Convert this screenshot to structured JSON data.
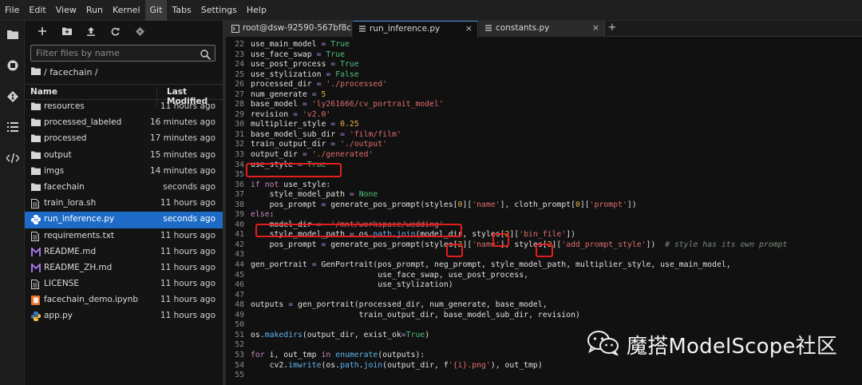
{
  "menubar": {
    "items": [
      "File",
      "Edit",
      "View",
      "Run",
      "Kernel",
      "Git",
      "Tabs",
      "Settings",
      "Help"
    ],
    "active_index": 5
  },
  "activity_icons": [
    "folder-icon",
    "running-icon",
    "git-icon",
    "list-icon",
    "code-icon"
  ],
  "filebrowser": {
    "toolbar_icons": [
      "new-launcher-icon",
      "new-folder-icon",
      "upload-icon",
      "refresh-icon",
      "git-clone-icon"
    ],
    "filter_placeholder": "Filter files by name",
    "breadcrumb": "/ facechain /",
    "columns": {
      "name": "Name",
      "modified": "Last Modified"
    },
    "files": [
      {
        "name": "resources",
        "modified": "11 hours ago",
        "type": "folder"
      },
      {
        "name": "processed_labeled",
        "modified": "16 minutes ago",
        "type": "folder"
      },
      {
        "name": "processed",
        "modified": "17 minutes ago",
        "type": "folder"
      },
      {
        "name": "output",
        "modified": "15 minutes ago",
        "type": "folder"
      },
      {
        "name": "imgs",
        "modified": "14 minutes ago",
        "type": "folder"
      },
      {
        "name": "facechain",
        "modified": "seconds ago",
        "type": "folder"
      },
      {
        "name": "train_lora.sh",
        "modified": "11 hours ago",
        "type": "file"
      },
      {
        "name": "run_inference.py",
        "modified": "seconds ago",
        "type": "python",
        "selected": true
      },
      {
        "name": "requirements.txt",
        "modified": "11 hours ago",
        "type": "file"
      },
      {
        "name": "README.md",
        "modified": "11 hours ago",
        "type": "markdown"
      },
      {
        "name": "README_ZH.md",
        "modified": "11 hours ago",
        "type": "markdown"
      },
      {
        "name": "LICENSE",
        "modified": "11 hours ago",
        "type": "file"
      },
      {
        "name": "facechain_demo.ipynb",
        "modified": "11 hours ago",
        "type": "notebook"
      },
      {
        "name": "app.py",
        "modified": "11 hours ago",
        "type": "python"
      }
    ]
  },
  "tabs": [
    {
      "label": "root@dsw-92590-567bf8c",
      "icon": "terminal-icon",
      "active": false
    },
    {
      "label": "run_inference.py",
      "icon": "file-icon",
      "active": true
    },
    {
      "label": "constants.py",
      "icon": "file-icon",
      "active": false
    }
  ],
  "editor": {
    "first_line_partial": "21",
    "lines": [
      {
        "n": "22",
        "code": "use_main_model = True"
      },
      {
        "n": "23",
        "code": "use_face_swap = True"
      },
      {
        "n": "24",
        "code": "use_post_process = True"
      },
      {
        "n": "25",
        "code": "use_stylization = False"
      },
      {
        "n": "26",
        "code": "processed_dir = './processed'"
      },
      {
        "n": "27",
        "code": "num_generate = 5"
      },
      {
        "n": "28",
        "code": "base_model = 'ly261666/cv_portrait_model'"
      },
      {
        "n": "29",
        "code": "revision = 'v2.0'"
      },
      {
        "n": "30",
        "code": "multiplier_style = 0.25"
      },
      {
        "n": "31",
        "code": "base_model_sub_dir = 'film/film'"
      },
      {
        "n": "32",
        "code": "train_output_dir = './output'"
      },
      {
        "n": "33",
        "code": "output_dir = './generated'"
      },
      {
        "n": "34",
        "code": "use_style = True"
      },
      {
        "n": "35",
        "code": ""
      },
      {
        "n": "36",
        "code": "if not use_style:"
      },
      {
        "n": "37",
        "code": "    style_model_path = None"
      },
      {
        "n": "38",
        "code": "    pos_prompt = generate_pos_prompt(styles[0]['name'], cloth_prompt[0]['prompt'])"
      },
      {
        "n": "39",
        "code": "else:"
      },
      {
        "n": "40",
        "code": "    model_dir =  '/mnt/workspace/wedding'"
      },
      {
        "n": "41",
        "code": "    style_model_path = os.path.join(model_dir, styles[2]['bin_file'])"
      },
      {
        "n": "42",
        "code": "    pos_prompt = generate_pos_prompt(styles[2]['name'], styles[2]['add_prompt_style'])  # style has its own prompt"
      },
      {
        "n": "43",
        "code": ""
      },
      {
        "n": "44",
        "code": "gen_portrait = GenPortrait(pos_prompt, neg_prompt, style_model_path, multiplier_style, use_main_model,"
      },
      {
        "n": "45",
        "code": "                           use_face_swap, use_post_process,"
      },
      {
        "n": "46",
        "code": "                           use_stylization)"
      },
      {
        "n": "47",
        "code": ""
      },
      {
        "n": "48",
        "code": "outputs = gen_portrait(processed_dir, num_generate, base_model,"
      },
      {
        "n": "49",
        "code": "                       train_output_dir, base_model_sub_dir, revision)"
      },
      {
        "n": "50",
        "code": ""
      },
      {
        "n": "51",
        "code": "os.makedirs(output_dir, exist_ok=True)"
      },
      {
        "n": "52",
        "code": ""
      },
      {
        "n": "53",
        "code": "for i, out_tmp in enumerate(outputs):"
      },
      {
        "n": "54",
        "code": "    cv2.imwrite(os.path.join(output_dir, f'{i}.png'), out_tmp)"
      },
      {
        "n": "55",
        "code": ""
      }
    ]
  },
  "watermark": {
    "text": "魔搭ModelScope社区",
    "icon": "wechat-icon"
  },
  "colors": {
    "accent": "#1d6bc6",
    "highlight_box": "#e41e1e"
  }
}
